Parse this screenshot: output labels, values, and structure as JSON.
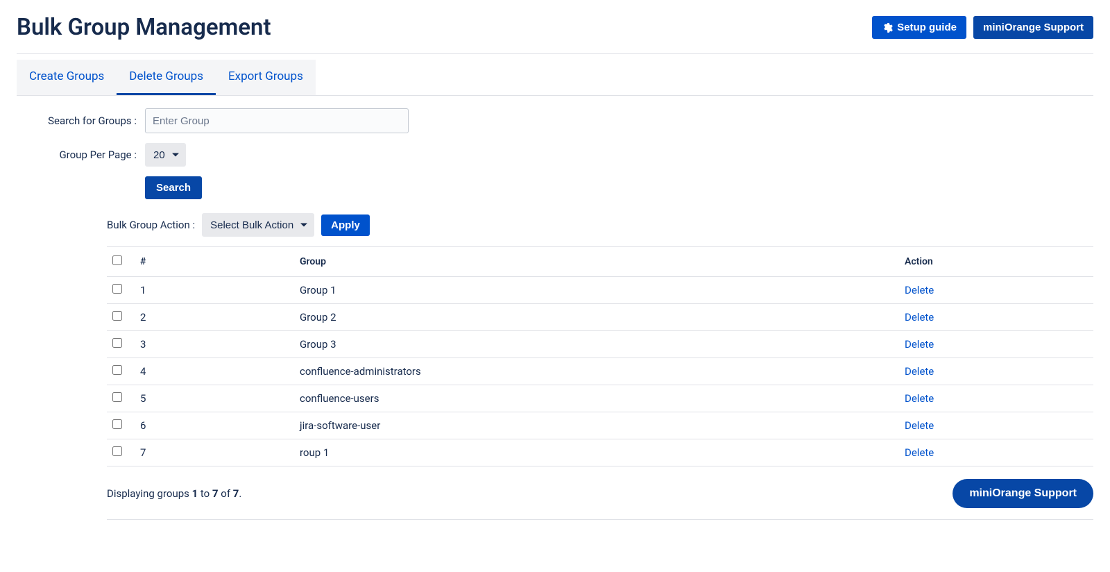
{
  "header": {
    "title": "Bulk Group Management",
    "setup_guide": "Setup guide",
    "support": "miniOrange Support"
  },
  "tabs": [
    {
      "label": "Create Groups",
      "active": false
    },
    {
      "label": "Delete Groups",
      "active": true
    },
    {
      "label": "Export Groups",
      "active": false
    }
  ],
  "search": {
    "label": "Search for Groups :",
    "placeholder": "Enter Group"
  },
  "per_page": {
    "label": "Group Per Page :",
    "value": "20"
  },
  "search_btn": "Search",
  "bulk": {
    "label": "Bulk Group Action :",
    "value": "Select Bulk Action",
    "apply": "Apply"
  },
  "table": {
    "cols": {
      "num": "#",
      "group": "Group",
      "action": "Action"
    },
    "delete": "Delete",
    "rows": [
      {
        "n": "1",
        "group": "Group 1"
      },
      {
        "n": "2",
        "group": "Group 2"
      },
      {
        "n": "3",
        "group": "Group 3"
      },
      {
        "n": "4",
        "group": "confluence-administrators"
      },
      {
        "n": "5",
        "group": "confluence-users"
      },
      {
        "n": "6",
        "group": "jira-software-user"
      },
      {
        "n": "7",
        "group": "roup 1"
      }
    ]
  },
  "footer": {
    "display_prefix": "Displaying groups ",
    "from": "1",
    "to_word": " to ",
    "to": "7",
    "of_word": " of ",
    "total": "7",
    "period": ".",
    "support_pill": "miniOrange Support"
  }
}
